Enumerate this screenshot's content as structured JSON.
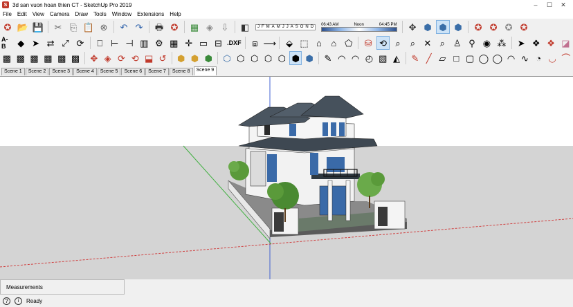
{
  "window": {
    "title": "3d san vuon hoan thien CT - SketchUp Pro 2019",
    "app_icon_letter": "S",
    "controls": [
      "–",
      "☐",
      "✕"
    ]
  },
  "menu": [
    "File",
    "Edit",
    "View",
    "Camera",
    "Draw",
    "Tools",
    "Window",
    "Extensions",
    "Help"
  ],
  "shadow": {
    "months": [
      "J",
      "F",
      "M",
      "A",
      "M",
      "J",
      "J",
      "A",
      "S",
      "O",
      "N",
      "D"
    ],
    "time_start": "06:43 AM",
    "time_mid": "Noon",
    "time_end": "04:45 PM"
  },
  "toolbar_labels": {
    "ab_label": "A-B",
    "dxf_label": ".DXF"
  },
  "scenes": [
    "Scene 1",
    "Scene 2",
    "Scene 3",
    "Scene 4",
    "Scene 5",
    "Scene 6",
    "Scene 7",
    "Scene 8",
    "Scene 9"
  ],
  "active_scene": "Scene 9",
  "measurements_label": "Measurements",
  "status_text": "Ready",
  "colors": {
    "sky": "#ffffff",
    "ground": "#d4d4d4",
    "roof": "#4a5560",
    "wall": "#f2f2f2",
    "glass": "#4a78b8",
    "tree": "#5a9a3a",
    "axis_red": "#d04040",
    "axis_green": "#40b040",
    "axis_blue": "#4060d0"
  }
}
